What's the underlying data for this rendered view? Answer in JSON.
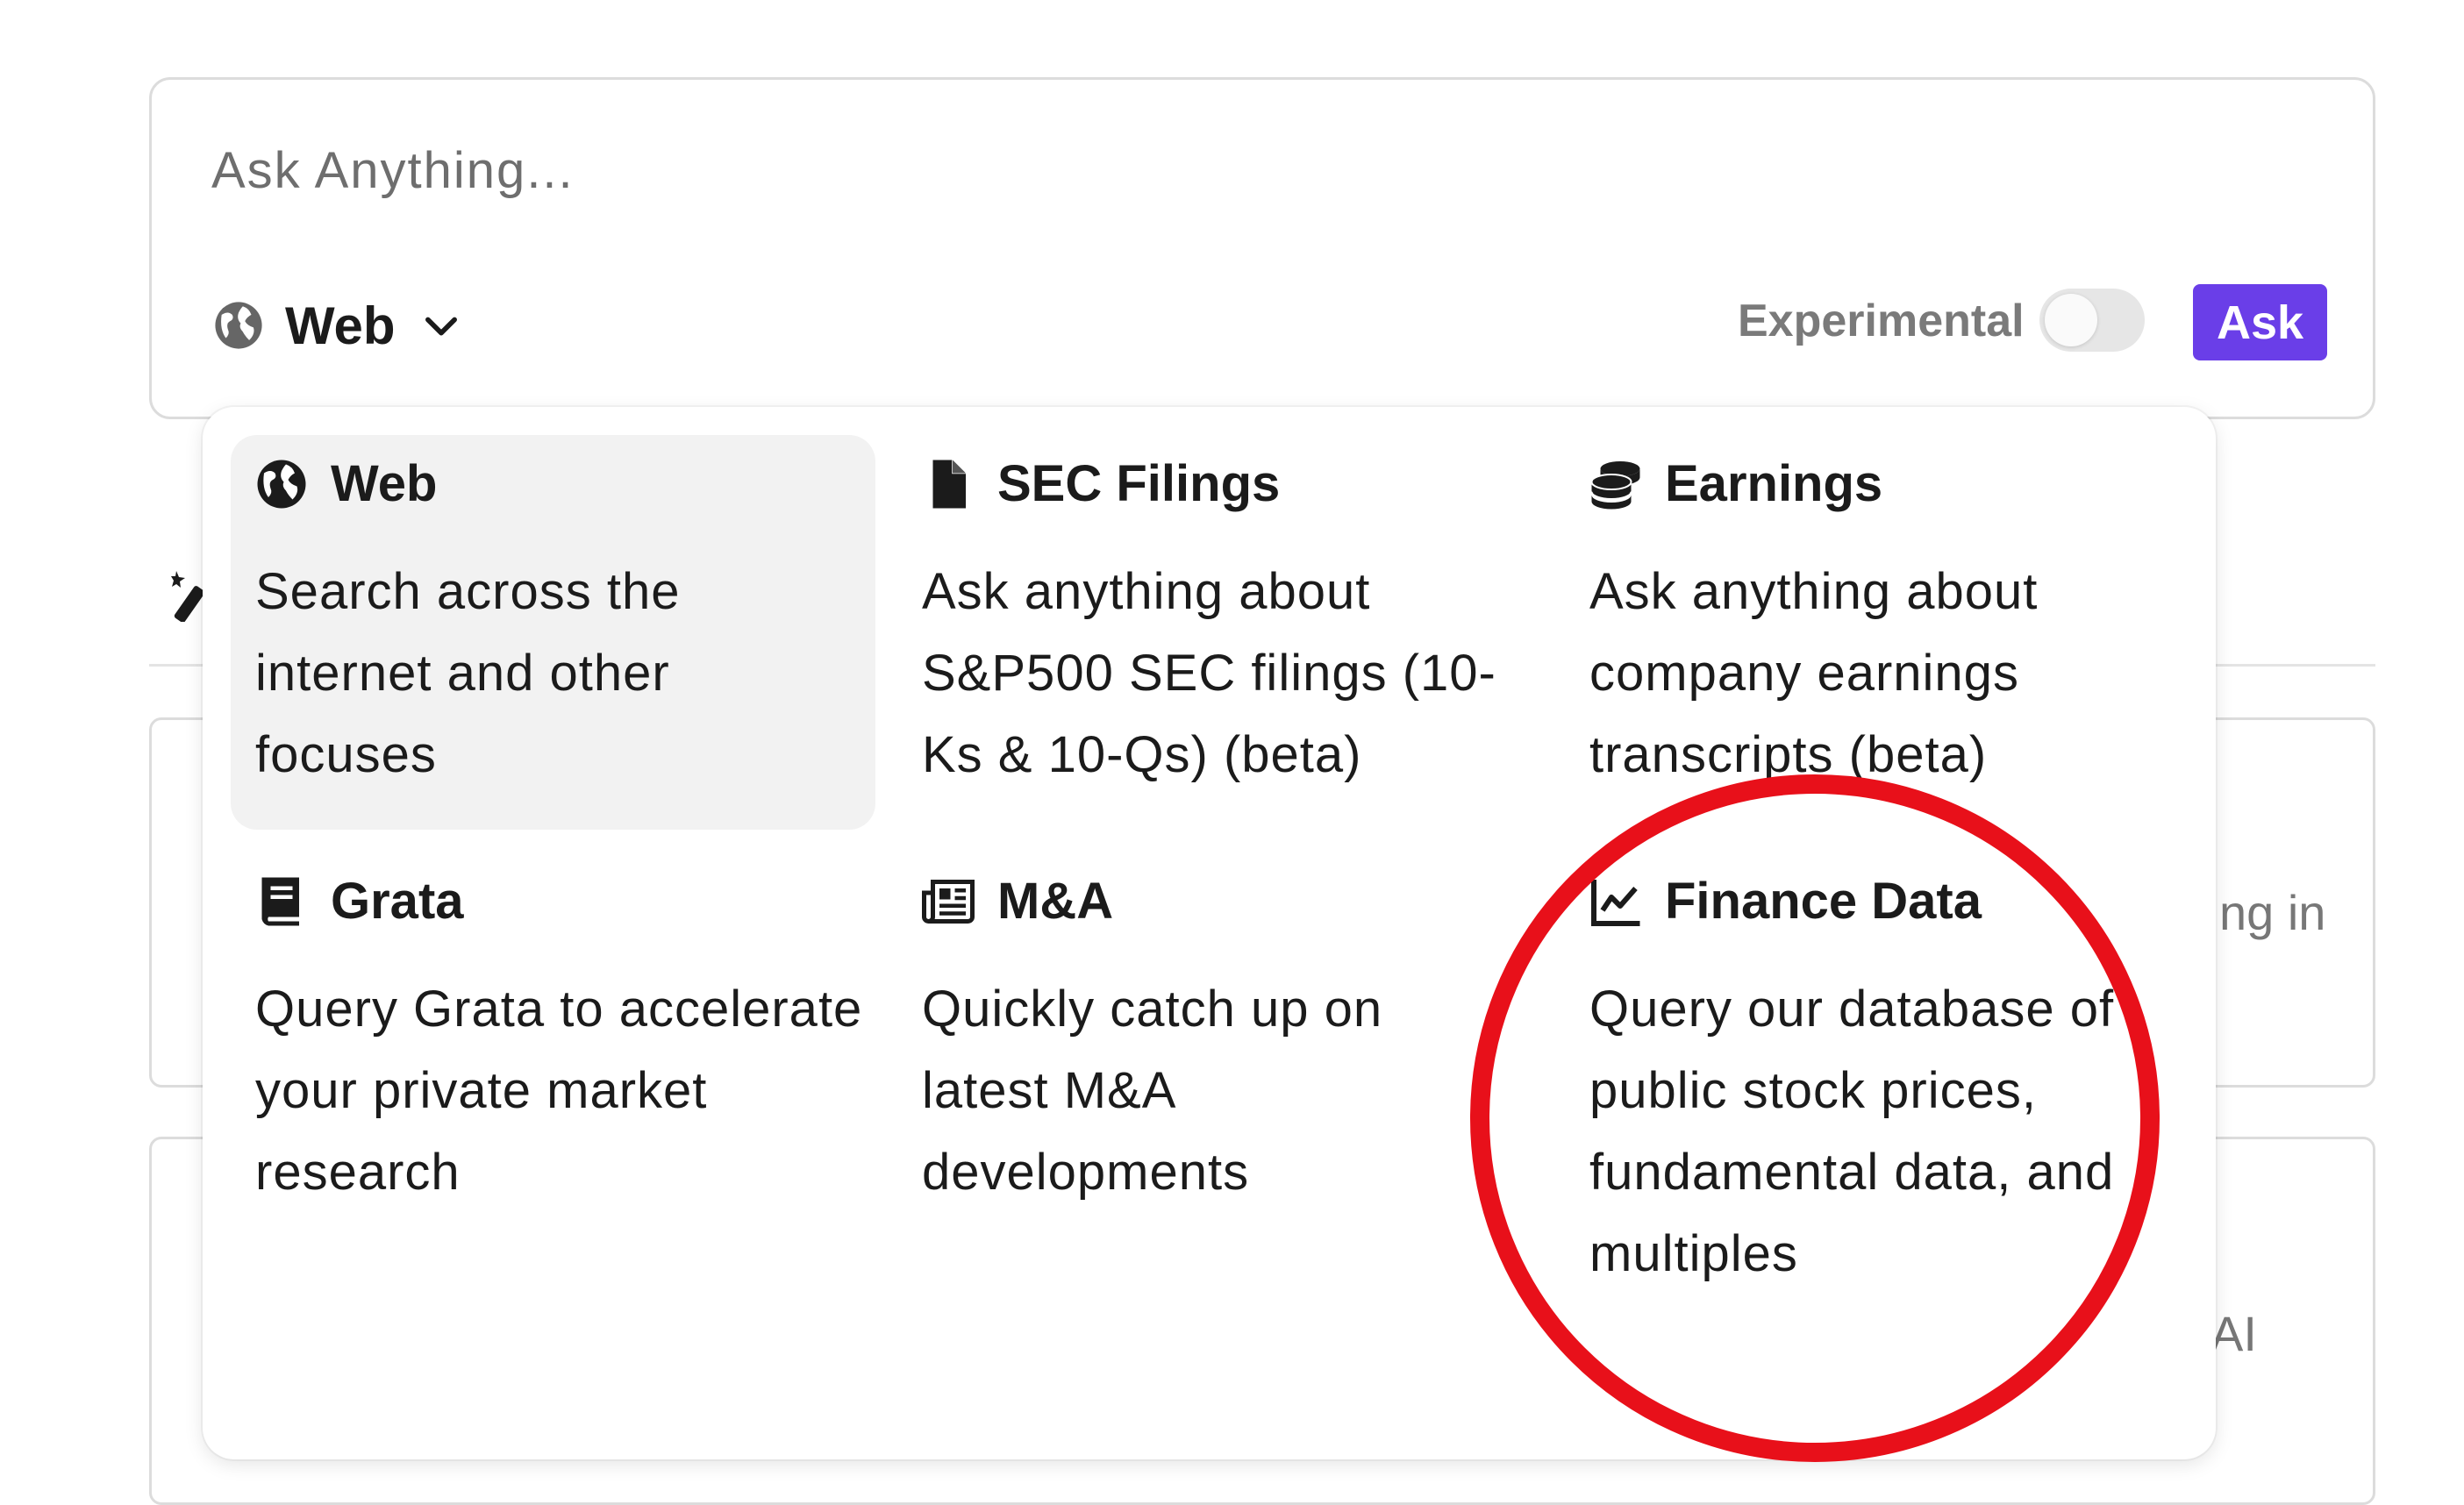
{
  "search": {
    "placeholder": "Ask Anything..."
  },
  "focus": {
    "current": "Web",
    "icon": "globe-icon"
  },
  "experimental": {
    "label": "Experimental",
    "enabled": false
  },
  "ask_button": {
    "label": "Ask",
    "color": "#6a3ee8"
  },
  "background_fragments": {
    "right_text_1": "ng in",
    "right_text_2": "AI"
  },
  "focus_options": [
    {
      "title": "Web",
      "icon": "globe-icon",
      "description": "Search across the internet and other focuses",
      "selected": true
    },
    {
      "title": "SEC Filings",
      "icon": "file-icon",
      "description": "Ask anything about S&P500 SEC filings (10-Ks & 10-Qs) (beta)",
      "selected": false
    },
    {
      "title": "Earnings",
      "icon": "coins-icon",
      "description": "Ask anything about company earnings transcripts (beta)",
      "selected": false
    },
    {
      "title": "Grata",
      "icon": "book-icon",
      "description": "Query Grata to accelerate your private market research",
      "selected": false
    },
    {
      "title": "M&A",
      "icon": "newspaper-icon",
      "description": "Quickly catch up on latest M&A developments",
      "selected": false
    },
    {
      "title": "Finance Data",
      "icon": "chart-line-icon",
      "description": "Query our database of public stock prices, fundamental data, and multiples",
      "selected": false
    }
  ],
  "annotation": {
    "color": "#e8101a",
    "target": "Finance Data"
  }
}
